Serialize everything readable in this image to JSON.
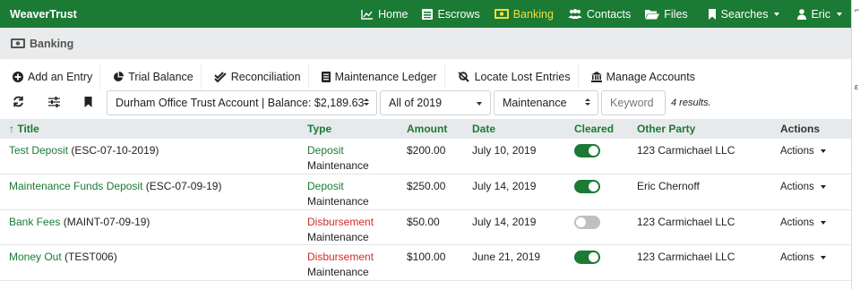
{
  "navbar": {
    "brand": "WeaverTrust",
    "links": [
      {
        "label": "Home",
        "icon": "area-chart-icon"
      },
      {
        "label": "Escrows",
        "icon": "list-alt-icon"
      },
      {
        "label": "Banking",
        "icon": "money-bill-icon",
        "active": true
      },
      {
        "label": "Contacts",
        "icon": "users-icon"
      },
      {
        "label": "Files",
        "icon": "folder-open-icon"
      },
      {
        "label": "Searches",
        "icon": "bookmark-icon",
        "dropdown": true
      },
      {
        "label": "Eric",
        "icon": "user-icon",
        "dropdown": true
      }
    ]
  },
  "breadcrumb": {
    "label": "Banking",
    "icon": "money-bill-icon"
  },
  "tabs": [
    {
      "label": "Add an Entry",
      "icon": "plus-circle-icon"
    },
    {
      "label": "Trial Balance",
      "icon": "pie-chart-icon"
    },
    {
      "label": "Reconciliation",
      "icon": "check-double-icon"
    },
    {
      "label": "Maintenance Ledger",
      "icon": "list-icon"
    },
    {
      "label": "Locate Lost Entries",
      "icon": "search-minus-icon"
    },
    {
      "label": "Manage Accounts",
      "icon": "bank-icon"
    }
  ],
  "filters": {
    "account": "Durham Office Trust Account | Balance: $2,189.63",
    "period": "All of 2019",
    "category": "Maintenance",
    "keyword_placeholder": "Keyword",
    "results": "4 results."
  },
  "table": {
    "columns": {
      "title": "↑ Title",
      "type": "Type",
      "amount": "Amount",
      "date": "Date",
      "cleared": "Cleared",
      "other": "Other Party",
      "actions": "Actions"
    },
    "rows": [
      {
        "title": "Test Deposit",
        "ref": "(ESC-07-10-2019)",
        "type": "Deposit",
        "kind": "deposit",
        "sub": "Maintenance",
        "amount": "$200.00",
        "date": "July 10, 2019",
        "cleared": true,
        "other": "123 Carmichael LLC",
        "actions": "Actions"
      },
      {
        "title": "Maintenance Funds Deposit",
        "ref": "(ESC-07-09-19)",
        "type": "Deposit",
        "kind": "deposit",
        "sub": "Maintenance",
        "amount": "$250.00",
        "date": "July 14, 2019",
        "cleared": true,
        "other": "Eric Chernoff",
        "actions": "Actions"
      },
      {
        "title": "Bank Fees",
        "ref": "(MAINT-07-09-19)",
        "type": "Disbursement",
        "kind": "disbursement",
        "sub": "Maintenance",
        "amount": "$50.00",
        "date": "July 14, 2019",
        "cleared": false,
        "other": "123 Carmichael LLC",
        "actions": "Actions"
      },
      {
        "title": "Money Out",
        "ref": "(TEST006)",
        "type": "Disbursement",
        "kind": "disbursement",
        "sub": "Maintenance",
        "amount": "$100.00",
        "date": "June 21, 2019",
        "cleared": true,
        "other": "123 Carmichael LLC",
        "actions": "Actions"
      }
    ]
  },
  "colors": {
    "brand": "#1b7a34",
    "active_nav": "#f2df3c",
    "disbursement": "#d42b2b"
  }
}
